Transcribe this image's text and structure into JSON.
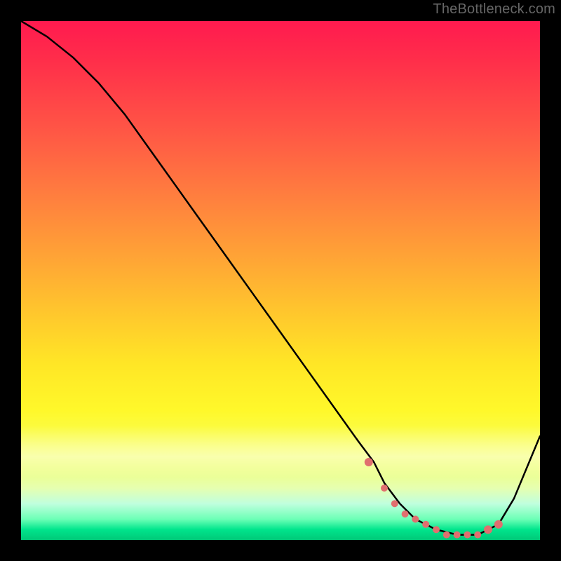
{
  "watermark": "TheBottleneck.com",
  "colors": {
    "background": "#000000",
    "curve": "#000000",
    "marker": "#e06f6f",
    "gradient_top": "#ff1a4f",
    "gradient_mid": "#ffe626",
    "gradient_bottom": "#00c878"
  },
  "chart_data": {
    "type": "line",
    "title": "",
    "xlabel": "",
    "ylabel": "",
    "xlim": [
      0,
      100
    ],
    "ylim": [
      0,
      100
    ],
    "grid": false,
    "legend": false,
    "series": [
      {
        "name": "bottleneck-curve",
        "x": [
          0,
          5,
          10,
          15,
          20,
          25,
          30,
          35,
          40,
          45,
          50,
          55,
          60,
          65,
          68,
          70,
          73,
          76,
          80,
          84,
          88,
          92,
          95,
          100
        ],
        "values": [
          100,
          97,
          93,
          88,
          82,
          75,
          68,
          61,
          54,
          47,
          40,
          33,
          26,
          19,
          15,
          11,
          7,
          4,
          2,
          1,
          1,
          3,
          8,
          20
        ]
      }
    ],
    "markers": {
      "name": "optimal-zone",
      "x": [
        67,
        70,
        72,
        74,
        76,
        78,
        80,
        82,
        84,
        86,
        88,
        90,
        92
      ],
      "values": [
        15,
        10,
        7,
        5,
        4,
        3,
        2,
        1,
        1,
        1,
        1,
        2,
        3
      ]
    }
  }
}
